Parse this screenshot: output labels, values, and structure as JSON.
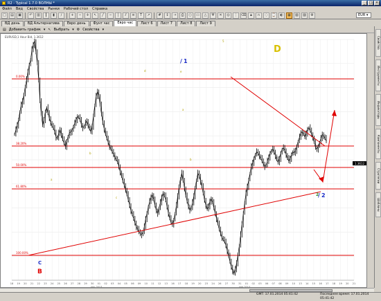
{
  "window": {
    "title": "R2 - Typical 1.7.0 ВОЛНЫ *"
  },
  "menu": [
    "Файл",
    "Вид",
    "Свойства",
    "Рынки",
    "Рабочий стол",
    "Справка"
  ],
  "toolbar": {
    "symbol": "EUR"
  },
  "tabs": [
    "ВД день",
    "ВД Альтернатива",
    "Евро день",
    "Фунт час",
    "Евро час",
    "Лист 6",
    "Лист 7",
    "Лист 8",
    "Лист 9"
  ],
  "active_tab": 4,
  "chart_toolbar": {
    "add_chart": "Добавить график",
    "select": "Выбрать",
    "properties": "Свойства"
  },
  "chart_header": "EURUSD,1 Hour Bid, 1.3612",
  "side_tabs": [
    "Свойства",
    "Инструменты",
    "Индикаторы",
    "Компоненты",
    "Стратегии",
    "Шаблоны"
  ],
  "status": {
    "left": "GMT: 17.01.2014 05:41:42",
    "right": "Последнее время: 17.01.2014 05:41:42"
  },
  "labels": {
    "wave_D": "D",
    "wave_1": "1",
    "wave_C": "C",
    "wave_B": "B",
    "wave_2": "2",
    "small_wave_labels": [
      "a",
      "b",
      "c",
      "d",
      "e",
      "5"
    ]
  },
  "levels": [
    {
      "label": "0.00%",
      "color": "#e00000"
    },
    {
      "label": "38.20%",
      "color": "#e00000"
    },
    {
      "label": "50.00%",
      "color": "#e00000"
    },
    {
      "label": "61.80%",
      "color": "#e00000"
    },
    {
      "label": "100.00%",
      "color": "#e00000"
    }
  ],
  "price_marker": "1.3612",
  "x_axis": {
    "ticks": [
      "18",
      "19",
      "20",
      "21",
      "22",
      "23",
      "24",
      "25",
      "26",
      "27",
      "28",
      "29",
      "30",
      "01",
      "02",
      "03",
      "04",
      "05",
      "06",
      "09",
      "10",
      "11",
      "12",
      "13",
      "16",
      "17",
      "18",
      "19",
      "20",
      "23",
      "24",
      "26",
      "27",
      "30",
      "31",
      "01",
      "02",
      "03",
      "06",
      "07",
      "08",
      "09",
      "10",
      "13",
      "14",
      "15",
      "16",
      "17",
      "18",
      "19",
      "20",
      "21"
    ],
    "month_labels": [
      "дек 2013",
      "янв 2014"
    ]
  },
  "chart_data": {
    "type": "line",
    "series": [
      {
        "values": [
          218,
          225,
          232,
          240,
          252,
          262,
          268,
          277,
          290,
          300,
          312,
          322,
          330,
          345,
          352,
          358,
          340,
          325,
          300,
          270,
          248,
          232,
          240,
          252,
          258,
          250,
          242,
          236,
          230,
          228,
          222,
          214,
          212,
          220,
          225,
          218,
          210,
          205,
          200,
          208,
          215,
          220,
          222,
          224,
          230,
          235,
          240,
          245,
          243,
          240,
          232,
          228,
          230,
          235,
          238,
          232,
          226,
          222,
          230,
          246,
          262,
          275,
          282,
          276,
          262,
          248,
          236,
          226,
          218,
          212,
          206,
          200,
          196,
          192,
          188,
          184,
          180,
          177,
          170,
          162,
          155,
          148,
          142,
          136,
          128,
          120,
          112,
          104,
          98,
          92,
          86,
          80,
          76,
          72,
          70,
          68,
          72,
          80,
          92,
          100,
          110,
          118,
          124,
          128,
          120,
          112,
          104,
          100,
          108,
          116,
          124,
          130,
          126,
          120,
          110,
          100,
          92,
          86,
          84,
          90,
          100,
          112,
          126,
          140,
          152,
          160,
          150,
          138,
          126,
          118,
          110,
          105,
          108,
          116,
          126,
          138,
          150,
          160,
          156,
          148,
          140,
          130,
          120,
          112,
          106,
          110,
          118,
          122,
          116,
          108,
          100,
          92,
          84,
          76,
          70,
          64,
          60,
          58,
          52,
          44,
          36,
          28,
          20,
          14,
          10,
          16,
          26,
          38,
          52,
          68,
          84,
          100,
          116,
          130,
          140,
          150,
          160,
          170,
          176,
          182,
          188,
          192,
          190,
          186,
          182,
          178,
          174,
          170,
          172,
          178,
          184,
          190,
          194,
          196,
          192,
          186,
          180,
          176,
          182,
          190,
          196,
          198,
          194,
          188,
          182,
          178,
          182,
          188,
          192,
          190,
          194,
          200,
          208,
          214,
          220,
          222,
          218,
          214,
          220,
          226,
          228,
          224,
          218,
          214,
          206,
          198,
          196,
          200,
          206,
          212,
          218,
          216,
          212,
          208
        ]
      }
    ],
    "ylim": [
      0,
      360
    ],
    "grid": true
  }
}
